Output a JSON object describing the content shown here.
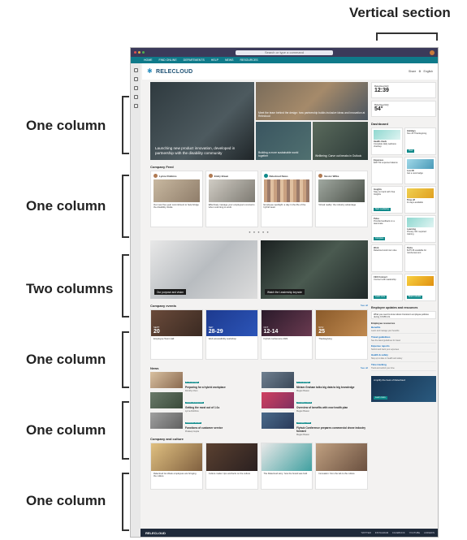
{
  "annotations": {
    "vertical_section": "Vertical section",
    "labels": [
      "One column",
      "One column",
      "Two columns",
      "One column",
      "One column",
      "One column"
    ]
  },
  "browser": {
    "search_placeholder": "Search or type a command"
  },
  "app_nav": [
    "HOME",
    "FIND ONLINE",
    "DEPARTMENTS",
    "HELP",
    "NEWS",
    "RESOURCES"
  ],
  "site": {
    "logo_text": "RELECLOUD",
    "share": "Share",
    "language": "English"
  },
  "hero": {
    "main": "Launching new product innovation, developed in partnership with the disability community",
    "wide": "Meet the team behind the design: how partnership builds inclusive ideas and innovation at Relecloud",
    "tile_a": "Building a more sustainable world together",
    "tile_b": "Wellbeing: Carve out breaks in Outlook"
  },
  "feed": {
    "title": "Company Feed",
    "cards": [
      {
        "name": "Lynne Robbins",
        "text": "Our new five-year commitment to help bridge the disability divide"
      },
      {
        "name": "Emily Braun",
        "text": "Effectively manage your employee's concerns when returning to work"
      },
      {
        "name": "Relecloud News",
        "text": "Employee spotlight: a day in the life of the hybrid team"
      },
      {
        "name": "Nestor Wilke",
        "text": "Virtual reality: the industry advantage"
      }
    ],
    "pager": "● ● ● ● ●"
  },
  "videos": {
    "left": "Our purpose and vision",
    "right": "Watch the Leadership keynote"
  },
  "events": {
    "title": "Company events",
    "see_all": "See all",
    "items": [
      {
        "month": "SEPT",
        "day": "20",
        "name": "Employee Town Hall"
      },
      {
        "month": "SEP",
        "day": "28-29",
        "name": "Web accessibility workshop"
      },
      {
        "month": "OCT",
        "day": "12-14",
        "name": "Flyhub conference 2021"
      },
      {
        "month": "NOV",
        "day": "25",
        "name": "Thanksgiving"
      }
    ]
  },
  "news": {
    "title": "News",
    "see_all": "See all",
    "items": [
      {
        "tag": "In the spotlight",
        "title": "Preparing for a hybrid workplace",
        "sub": "Dorothy Chen"
      },
      {
        "tag": "In the spotlight",
        "title": "Miriam Graham talks big data to big knowledge",
        "sub": "Megan Bowen"
      },
      {
        "tag": "Career development",
        "title": "Getting the most out of 1:1s",
        "sub": "Lynne Robbins"
      },
      {
        "tag": "Company events",
        "title": "Overview of benefits with new health plan",
        "sub": "Megan Bowen"
      },
      {
        "tag": "Customer service",
        "title": "Functions of customer service",
        "sub": "Pradeep Gupta"
      },
      {
        "tag": "Company news",
        "title": "Flyhub Conference prepares commercial drone industry forward",
        "sub": "Megan Bowen"
      }
    ]
  },
  "culture": {
    "title": "Company and culture",
    "items": [
      {
        "text": "Relecloud Go Week employees are bringing the culture"
      },
      {
        "text": "Culture matter: tips and facts on the culture"
      },
      {
        "text": "The Relecloud story: how the brand was built"
      },
      {
        "text": "Innovation: from the lab to the culture"
      }
    ]
  },
  "side": {
    "weather1": {
      "location": "Relecloud HQ",
      "value": "12:39"
    },
    "weather2": {
      "location": "Relecloud HQ",
      "value": "54°"
    },
    "dashboard_title": "Dashboard",
    "dash": [
      {
        "title": "Health check",
        "text": "Complete daily wellness checkup",
        "btn": "Take"
      },
      {
        "title": "Holidays",
        "text": "Nov 25 Thanksgiving",
        "btn": "View"
      },
      {
        "title": "Expenses",
        "text": "$437.52 expense balance",
        "btn": "Submit"
      },
      {
        "title": "Lost ID",
        "text": "Get a new badge",
        "btn": "Request"
      },
      {
        "title": "Insights",
        "text": "Stay on track with Viva Insights",
        "btn": "Start meditating"
      },
      {
        "title": "Time off",
        "text": "11 days available",
        "btn": "Request"
      },
      {
        "title": "Pulse",
        "text": "Provide feedback on a teammate",
        "btn": "Complete"
      },
      {
        "title": "Learning",
        "text": "Privacy 101 required training",
        "btn": "Start"
      },
      {
        "title": "Work",
        "text": "Relecloud work item due",
        "btn": "View"
      },
      {
        "title": "Perks",
        "text": "$175.36 available for reimbursement",
        "btn": "View"
      },
      {
        "title": "CEO Connect",
        "text": "Connect with leadership",
        "btn": "Learn more"
      },
      {
        "title": "Shuttle",
        "text": "Book a shuttle",
        "btn": "Book a shuttle"
      }
    ],
    "updates_title": "Employee updates and resources",
    "update_text": "What you need to know about Contoso's employee policies during COVID-19.",
    "resources_title": "Employee resources",
    "resources": [
      {
        "title": "Benefits",
        "sub": "Learn and manage your benefits"
      },
      {
        "title": "Travel guidelines",
        "sub": "See the latest guidelines for travel"
      },
      {
        "title": "Expense reports",
        "sub": "Submit and track your expenses"
      },
      {
        "title": "Health & safety",
        "sub": "Stay up to date on health and safety"
      },
      {
        "title": "Time tracking",
        "sub": "Track and submit your time"
      }
    ],
    "promo_text": "Amplify the best of Relecloud",
    "promo_btn": "Learn more"
  },
  "footer": {
    "logo": "RELECLOUD",
    "links": [
      "TWITTER",
      "INSTAGRAM",
      "FACEBOOK",
      "YOUTUBE",
      "LINKEDIN"
    ]
  },
  "colors": {
    "accent": "#0f8a8a",
    "nav": "#0f7a8a",
    "footer": "#1f2a3a",
    "titlebar": "#3b3a5a"
  }
}
